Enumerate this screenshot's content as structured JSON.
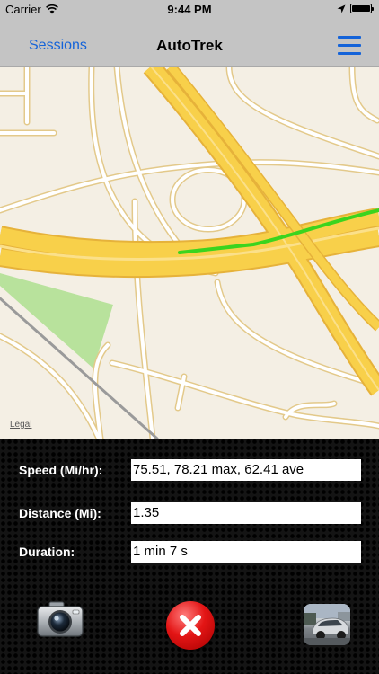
{
  "status_bar": {
    "carrier": "Carrier",
    "time": "9:44 PM",
    "wifi_icon": "wifi-icon",
    "location_icon": "location-arrow-icon",
    "battery_icon": "battery-icon"
  },
  "nav_bar": {
    "left_button": "Sessions",
    "title": "AutoTrek",
    "right_icon": "hamburger-menu-icon"
  },
  "map": {
    "legal_label": "Legal"
  },
  "stats": {
    "speed_label": "Speed (Mi/hr):",
    "speed_value": "75.51, 78.21 max, 62.41 ave",
    "distance_label": "Distance (Mi):",
    "distance_value": "1.35",
    "duration_label": "Duration:",
    "duration_value": "1 min 7 s"
  },
  "toolbar": {
    "camera_icon": "camera-icon",
    "cancel_icon": "red-x-cancel-icon",
    "photo_icon": "photo-thumbnail"
  },
  "colors": {
    "accent": "#1463d9",
    "route": "#3bd41e",
    "highway": "#f8d04a",
    "map_bg": "#f4efe4",
    "park": "#b8e29c",
    "cancel": "#e31515"
  }
}
